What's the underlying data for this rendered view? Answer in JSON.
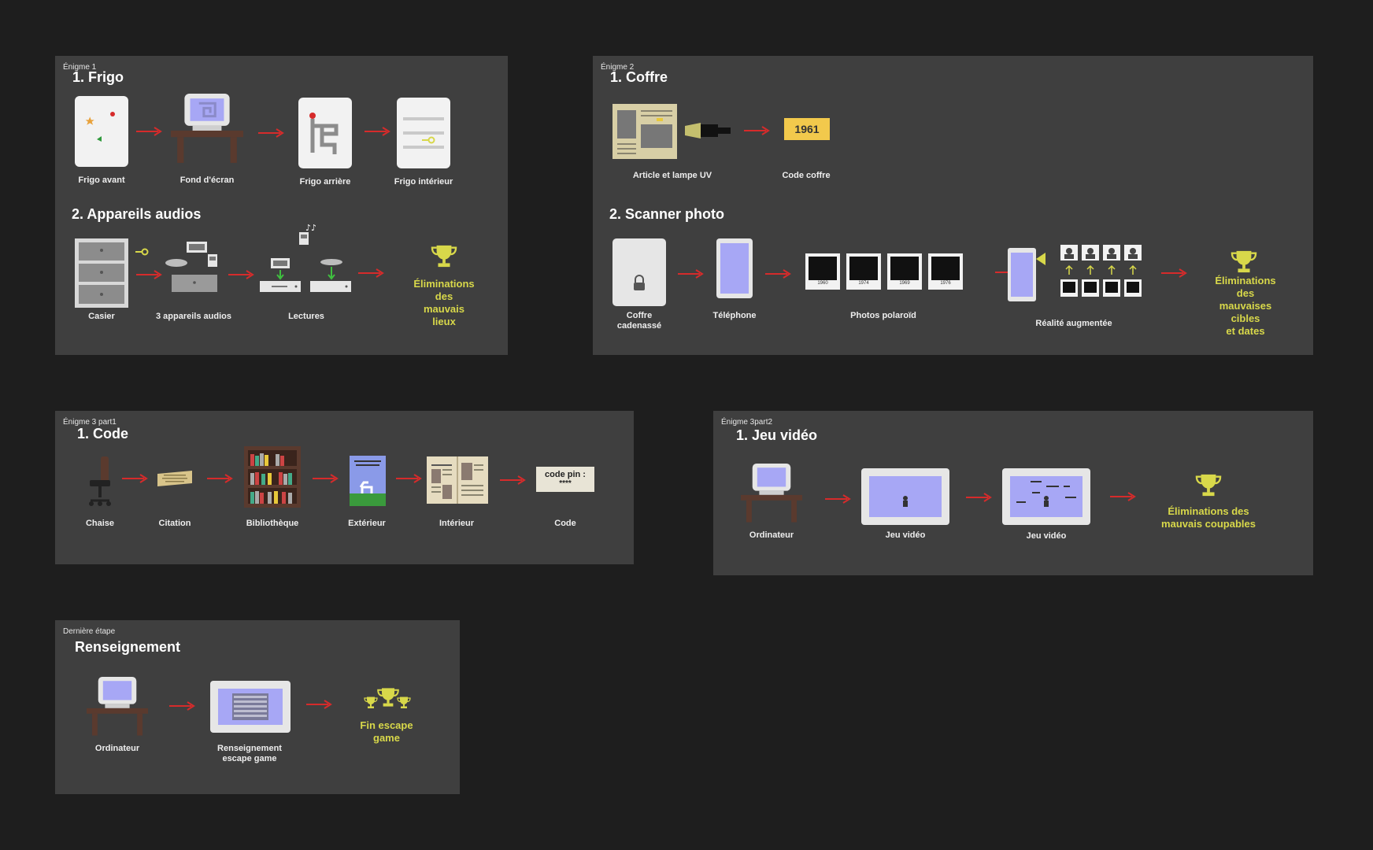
{
  "colors": {
    "background": "#1e1e1e",
    "frame": "#3f3f3f",
    "arrow": "#d62b2b",
    "trophy": "#d8d84a",
    "screen": "#a7a7f5"
  },
  "enigme1": {
    "tag": "Énigme 1",
    "s1_title": "1. Frigo",
    "s1_labels": [
      "Frigo avant",
      "Fond d'écran",
      "Frigo arrière",
      "Frigo intérieur"
    ],
    "s2_title": "2. Appareils audios",
    "s2_labels": [
      "Casier",
      "3 appareils audios",
      "Lectures"
    ],
    "trophy": "Éliminations des\nmauvais lieux"
  },
  "enigme2": {
    "tag": "Énigme 2",
    "s1_title": "1. Coffre",
    "s1_labels": [
      "Article et lampe UV",
      "Code coffre"
    ],
    "code_value": "1961",
    "s2_title": "2. Scanner photo",
    "s2_labels": [
      "Coffre\ncadenassé",
      "Téléphone",
      "Photos polaroïd",
      "Réalité augmentée"
    ],
    "polaroid_years": [
      "1960",
      "1974",
      "1969",
      "1976"
    ],
    "trophy": "Éliminations des\nmauvaises cibles\net dates"
  },
  "enigme3p1": {
    "tag": "Énigme 3 part1",
    "title": "1. Code",
    "labels": [
      "Chaise",
      "Citation",
      "Bibliothèque",
      "Extérieur",
      "Intérieur",
      "Code"
    ],
    "code_pin": "code pin :",
    "code_stars": "****"
  },
  "enigme3p2": {
    "tag": "Énigme 3part2",
    "title": "1. Jeu vidéo",
    "labels": [
      "Ordinateur",
      "Jeu vidéo",
      "Jeu vidéo"
    ],
    "trophy": "Éliminations des\nmauvais coupables"
  },
  "derniere": {
    "tag": "Dernière étape",
    "title": "Renseignement",
    "labels": [
      "Ordinateur",
      "Renseignement\nescape game"
    ],
    "trophy": "Fin escape game"
  }
}
